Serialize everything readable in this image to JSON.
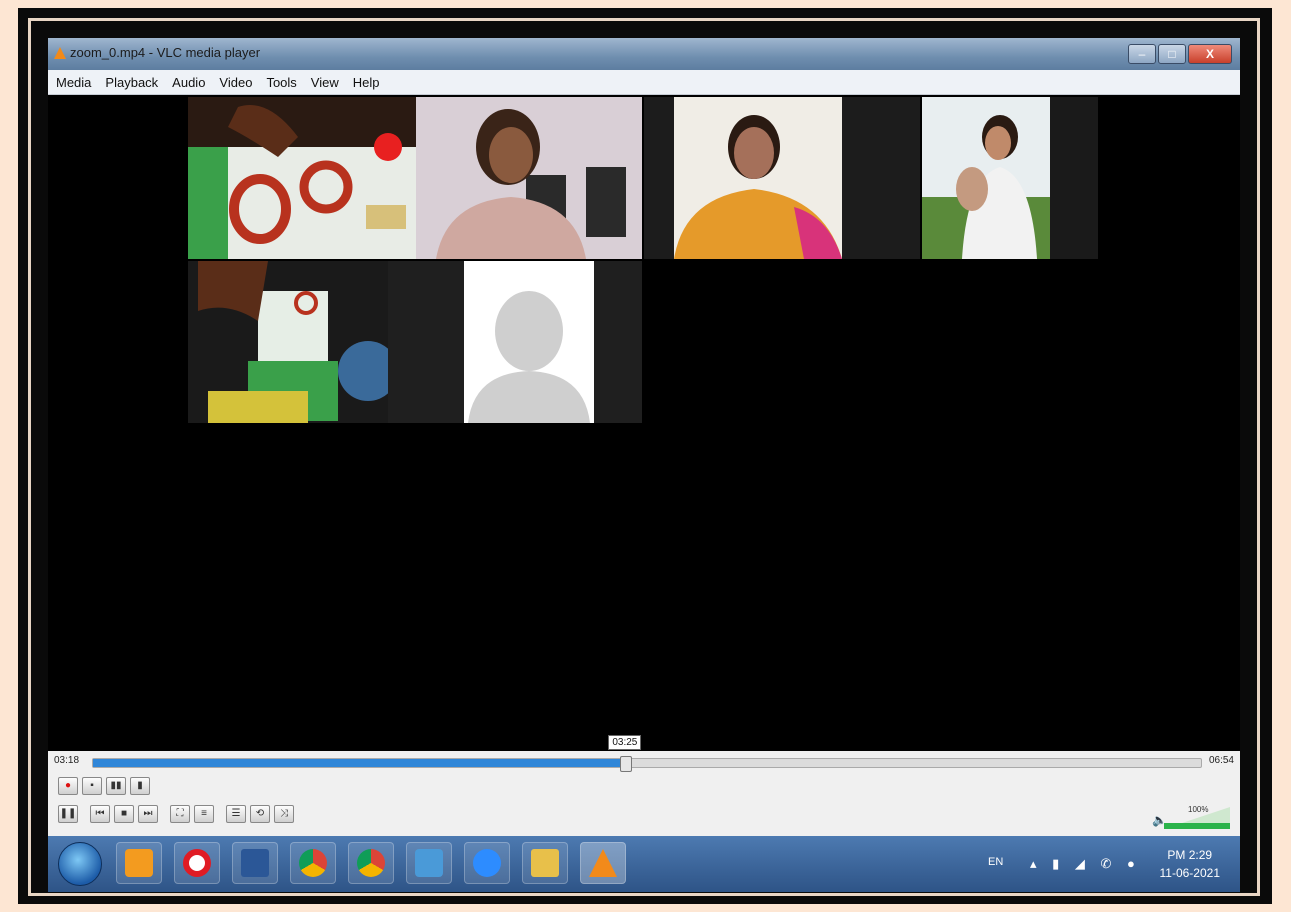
{
  "window": {
    "title": "zoom_0.mp4 - VLC media player",
    "controls": {
      "minimize": "–",
      "maximize": "□",
      "close": "X"
    }
  },
  "menu": [
    "Media",
    "Playback",
    "Audio",
    "Video",
    "Tools",
    "View",
    "Help"
  ],
  "playback": {
    "elapsed": "03:18",
    "total": "06:54",
    "tooltip": "03:25",
    "progress_fraction": 0.48
  },
  "volume": {
    "label": "100%",
    "level_fraction": 1.0
  },
  "taskbar": {
    "apps": [
      "windows-media-player",
      "opera",
      "word",
      "chrome",
      "chrome",
      "vpn-client",
      "zoom",
      "file-explorer",
      "vlc"
    ],
    "tray": {
      "language": "EN",
      "time": "PM 2:29",
      "date": "11-06-2021"
    }
  },
  "colors": {
    "accent": "#2f86d8",
    "frame": "#fde6d3"
  }
}
